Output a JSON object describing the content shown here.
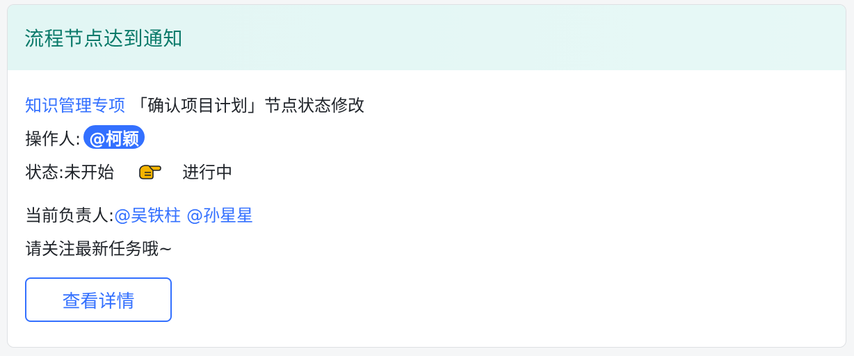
{
  "card": {
    "title": "流程节点达到通知",
    "project_link": "知识管理专项",
    "change_text": "「确认项目计划」节点状态修改",
    "operator_label": "操作人: ",
    "operator_mention": "@柯颖",
    "status_label": "状态: ",
    "status_from": "未开始",
    "status_to": "进行中",
    "owner_label": "当前负责人: ",
    "owners": [
      "@吴铁柱",
      "@孙星星"
    ],
    "reminder": "请关注最新任务哦~",
    "detail_button": "查看详情"
  },
  "colors": {
    "accent": "#3370ff",
    "header_bg": "#e2f6f4",
    "title": "#0b7a6a",
    "hand": "#f5b400"
  },
  "icons": {
    "status_arrow": "pointing-hand-icon"
  }
}
